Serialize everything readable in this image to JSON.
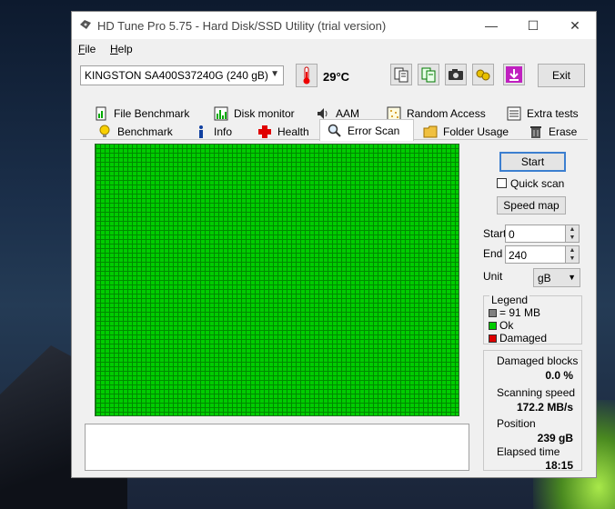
{
  "window": {
    "title": "HD Tune Pro 5.75 - Hard Disk/SSD Utility (trial version)",
    "controls": {
      "minimize": "—",
      "maximize": "☐",
      "close": "✕"
    }
  },
  "menu": [
    {
      "first": "F",
      "rest": "ile"
    },
    {
      "first": "H",
      "rest": "elp"
    }
  ],
  "toolbar": {
    "drive": "KINGSTON SA400S37240G (240 gB)",
    "temperature": "29°C",
    "exit_label": "Exit"
  },
  "tabs_top": [
    "File Benchmark",
    "Disk monitor",
    "AAM",
    "Random Access",
    "Extra tests"
  ],
  "tabs_bottom": [
    "Benchmark",
    "Info",
    "Health",
    "Error Scan",
    "Folder Usage",
    "Erase"
  ],
  "active_tab": "Error Scan",
  "scan": {
    "start_button": "Start",
    "quick_scan_label": "Quick scan",
    "quick_scan_checked": false,
    "speed_map_button": "Speed map",
    "start_label": "Start",
    "start_value": "0",
    "end_label": "End",
    "end_value": "240",
    "unit_label": "Unit",
    "unit_value": "gB"
  },
  "legend": {
    "title": "Legend",
    "items": [
      {
        "label": "= 91 MB",
        "color": "#808080"
      },
      {
        "label": "Ok",
        "color": "#00cc00"
      },
      {
        "label": "Damaged",
        "color": "#dd0000"
      }
    ]
  },
  "stats": {
    "damaged_blocks_label": "Damaged blocks",
    "damaged_blocks_value": "0.0 %",
    "scanning_speed_label": "Scanning speed",
    "scanning_speed_value": "172.2 MB/s",
    "position_label": "Position",
    "position_value": "239 gB",
    "elapsed_label": "Elapsed time",
    "elapsed_value": "18:15"
  },
  "colors": {
    "ok": "#00cc00",
    "grid_line": "#008800",
    "accent": "#3c7fd0"
  }
}
